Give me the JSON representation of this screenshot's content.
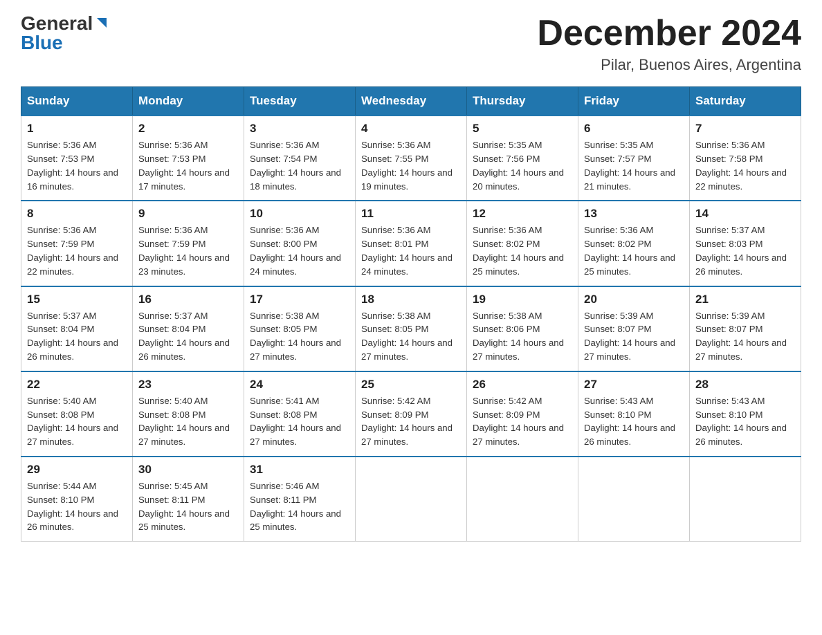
{
  "header": {
    "logo_general": "General",
    "logo_blue": "Blue",
    "title": "December 2024",
    "subtitle": "Pilar, Buenos Aires, Argentina"
  },
  "days_of_week": [
    "Sunday",
    "Monday",
    "Tuesday",
    "Wednesday",
    "Thursday",
    "Friday",
    "Saturday"
  ],
  "weeks": [
    [
      {
        "day": "1",
        "sunrise": "5:36 AM",
        "sunset": "7:53 PM",
        "daylight": "14 hours and 16 minutes."
      },
      {
        "day": "2",
        "sunrise": "5:36 AM",
        "sunset": "7:53 PM",
        "daylight": "14 hours and 17 minutes."
      },
      {
        "day": "3",
        "sunrise": "5:36 AM",
        "sunset": "7:54 PM",
        "daylight": "14 hours and 18 minutes."
      },
      {
        "day": "4",
        "sunrise": "5:36 AM",
        "sunset": "7:55 PM",
        "daylight": "14 hours and 19 minutes."
      },
      {
        "day": "5",
        "sunrise": "5:35 AM",
        "sunset": "7:56 PM",
        "daylight": "14 hours and 20 minutes."
      },
      {
        "day": "6",
        "sunrise": "5:35 AM",
        "sunset": "7:57 PM",
        "daylight": "14 hours and 21 minutes."
      },
      {
        "day": "7",
        "sunrise": "5:36 AM",
        "sunset": "7:58 PM",
        "daylight": "14 hours and 22 minutes."
      }
    ],
    [
      {
        "day": "8",
        "sunrise": "5:36 AM",
        "sunset": "7:59 PM",
        "daylight": "14 hours and 22 minutes."
      },
      {
        "day": "9",
        "sunrise": "5:36 AM",
        "sunset": "7:59 PM",
        "daylight": "14 hours and 23 minutes."
      },
      {
        "day": "10",
        "sunrise": "5:36 AM",
        "sunset": "8:00 PM",
        "daylight": "14 hours and 24 minutes."
      },
      {
        "day": "11",
        "sunrise": "5:36 AM",
        "sunset": "8:01 PM",
        "daylight": "14 hours and 24 minutes."
      },
      {
        "day": "12",
        "sunrise": "5:36 AM",
        "sunset": "8:02 PM",
        "daylight": "14 hours and 25 minutes."
      },
      {
        "day": "13",
        "sunrise": "5:36 AM",
        "sunset": "8:02 PM",
        "daylight": "14 hours and 25 minutes."
      },
      {
        "day": "14",
        "sunrise": "5:37 AM",
        "sunset": "8:03 PM",
        "daylight": "14 hours and 26 minutes."
      }
    ],
    [
      {
        "day": "15",
        "sunrise": "5:37 AM",
        "sunset": "8:04 PM",
        "daylight": "14 hours and 26 minutes."
      },
      {
        "day": "16",
        "sunrise": "5:37 AM",
        "sunset": "8:04 PM",
        "daylight": "14 hours and 26 minutes."
      },
      {
        "day": "17",
        "sunrise": "5:38 AM",
        "sunset": "8:05 PM",
        "daylight": "14 hours and 27 minutes."
      },
      {
        "day": "18",
        "sunrise": "5:38 AM",
        "sunset": "8:05 PM",
        "daylight": "14 hours and 27 minutes."
      },
      {
        "day": "19",
        "sunrise": "5:38 AM",
        "sunset": "8:06 PM",
        "daylight": "14 hours and 27 minutes."
      },
      {
        "day": "20",
        "sunrise": "5:39 AM",
        "sunset": "8:07 PM",
        "daylight": "14 hours and 27 minutes."
      },
      {
        "day": "21",
        "sunrise": "5:39 AM",
        "sunset": "8:07 PM",
        "daylight": "14 hours and 27 minutes."
      }
    ],
    [
      {
        "day": "22",
        "sunrise": "5:40 AM",
        "sunset": "8:08 PM",
        "daylight": "14 hours and 27 minutes."
      },
      {
        "day": "23",
        "sunrise": "5:40 AM",
        "sunset": "8:08 PM",
        "daylight": "14 hours and 27 minutes."
      },
      {
        "day": "24",
        "sunrise": "5:41 AM",
        "sunset": "8:08 PM",
        "daylight": "14 hours and 27 minutes."
      },
      {
        "day": "25",
        "sunrise": "5:42 AM",
        "sunset": "8:09 PM",
        "daylight": "14 hours and 27 minutes."
      },
      {
        "day": "26",
        "sunrise": "5:42 AM",
        "sunset": "8:09 PM",
        "daylight": "14 hours and 27 minutes."
      },
      {
        "day": "27",
        "sunrise": "5:43 AM",
        "sunset": "8:10 PM",
        "daylight": "14 hours and 26 minutes."
      },
      {
        "day": "28",
        "sunrise": "5:43 AM",
        "sunset": "8:10 PM",
        "daylight": "14 hours and 26 minutes."
      }
    ],
    [
      {
        "day": "29",
        "sunrise": "5:44 AM",
        "sunset": "8:10 PM",
        "daylight": "14 hours and 26 minutes."
      },
      {
        "day": "30",
        "sunrise": "5:45 AM",
        "sunset": "8:11 PM",
        "daylight": "14 hours and 25 minutes."
      },
      {
        "day": "31",
        "sunrise": "5:46 AM",
        "sunset": "8:11 PM",
        "daylight": "14 hours and 25 minutes."
      },
      null,
      null,
      null,
      null
    ]
  ]
}
